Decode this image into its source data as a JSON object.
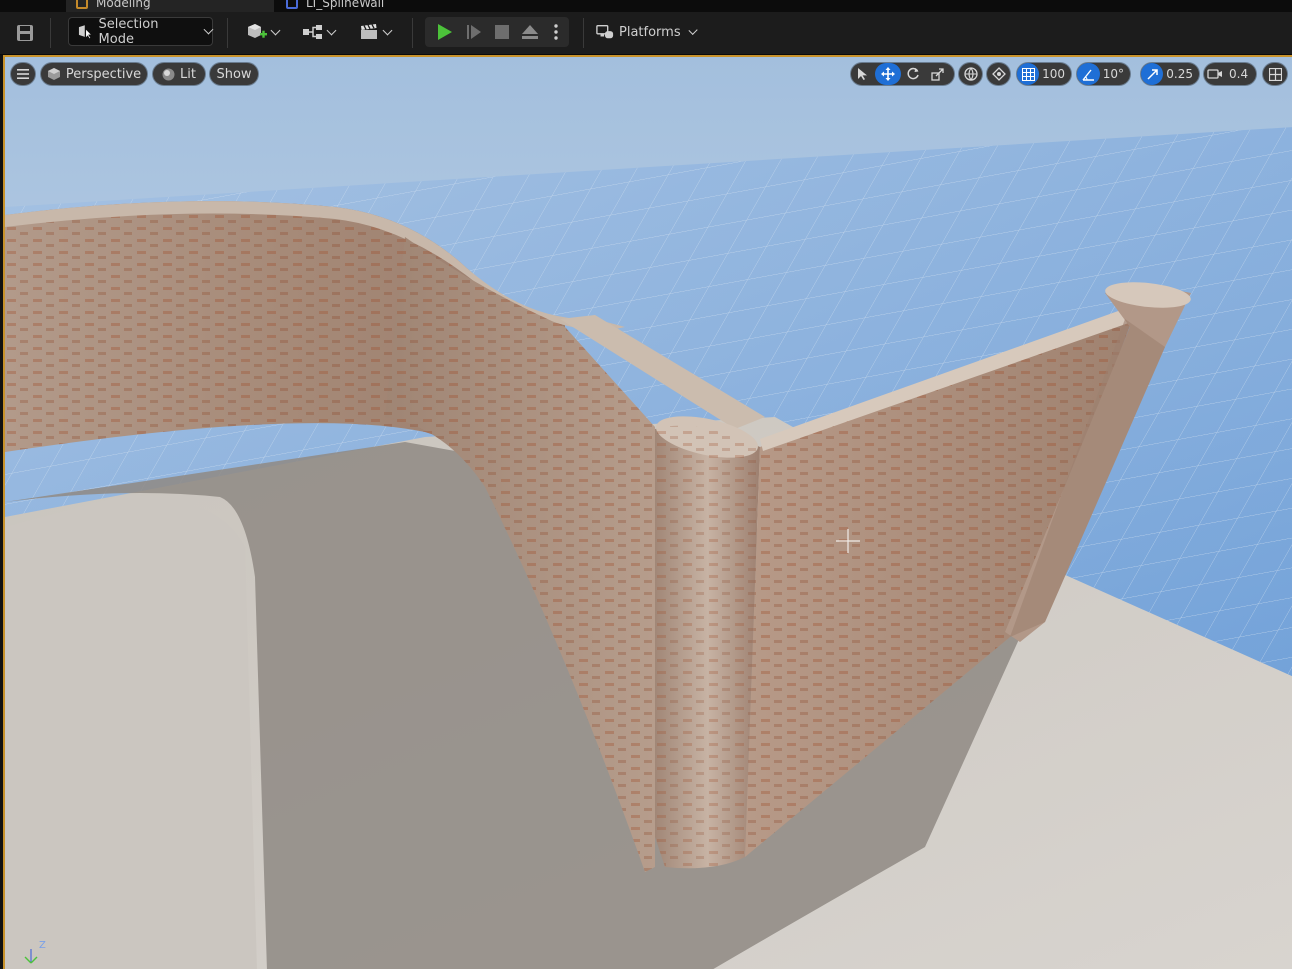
{
  "tabs": [
    {
      "label": "Modeling",
      "active": true
    },
    {
      "label": "LI_SplineWall",
      "active": false
    }
  ],
  "toolbar": {
    "save_icon": "save-icon",
    "selection_mode_label": "Selection Mode",
    "platforms_label": "Platforms"
  },
  "viewport": {
    "menu_icon": "hamburger-icon",
    "view_mode_label": "Perspective",
    "lit_label": "Lit",
    "show_label": "Show",
    "grid_snap_value": "100",
    "rotation_snap_value": "10°",
    "scale_snap_value": "0.25",
    "camera_speed_value": "0.4",
    "axis_label": "Z",
    "colors": {
      "accent": "#1f6fd6",
      "play_green": "#4cc23a",
      "viewport_border": "#c8922a"
    }
  }
}
